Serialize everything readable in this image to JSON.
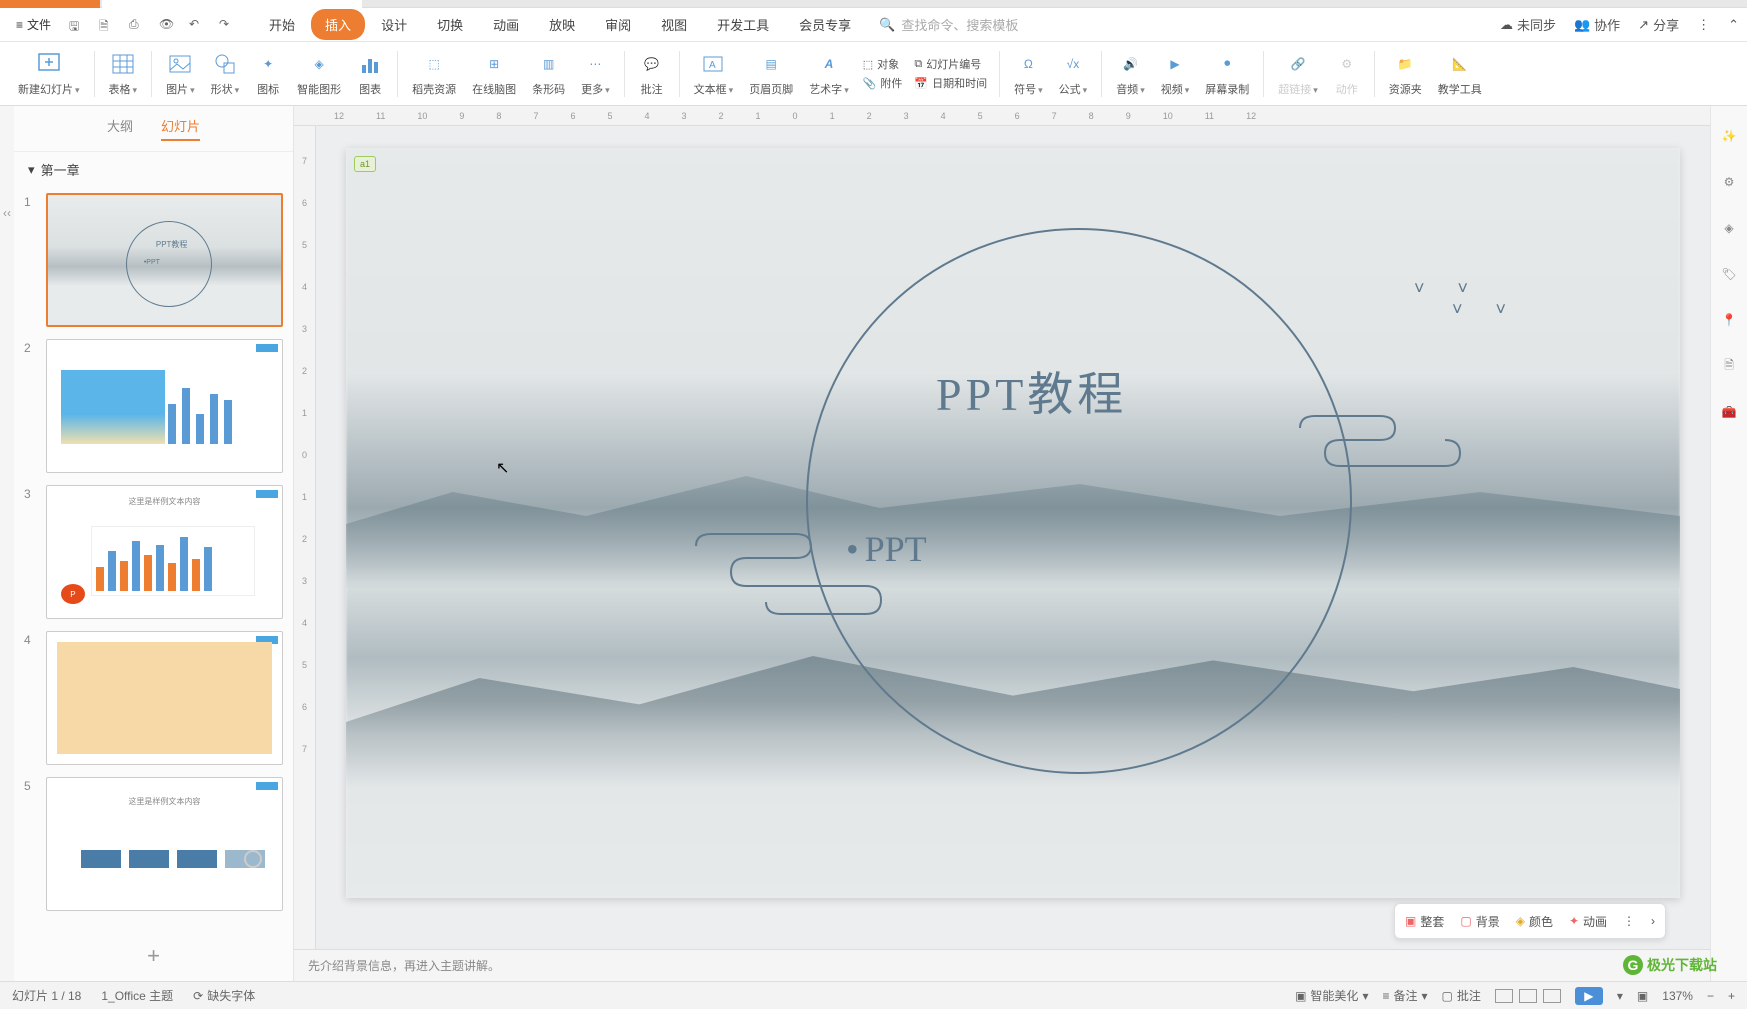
{
  "menubar": {
    "file": "文件",
    "tabs": [
      "开始",
      "插入",
      "设计",
      "切换",
      "动画",
      "放映",
      "审阅",
      "视图",
      "开发工具",
      "会员专享"
    ],
    "active_tab_index": 1,
    "search_placeholder": "查找命令、搜索模板",
    "right": {
      "unsync": "未同步",
      "collab": "协作",
      "share": "分享"
    }
  },
  "ribbon": {
    "items": [
      {
        "label": "新建幻灯片",
        "dd": true
      },
      {
        "label": "表格",
        "dd": true
      },
      {
        "label": "图片",
        "dd": true
      },
      {
        "label": "形状",
        "dd": true
      },
      {
        "label": "图标"
      },
      {
        "label": "智能图形"
      },
      {
        "label": "图表"
      },
      {
        "label": "稻壳资源"
      },
      {
        "label": "在线脑图"
      },
      {
        "label": "条形码"
      },
      {
        "label": "更多",
        "dd": true
      },
      {
        "label": "批注"
      },
      {
        "label": "文本框",
        "dd": true
      },
      {
        "label": "页眉页脚"
      },
      {
        "label": "艺术字",
        "dd": true
      },
      {
        "label": "符号",
        "dd": true
      },
      {
        "label": "公式",
        "dd": true
      },
      {
        "label": "音频",
        "dd": true
      },
      {
        "label": "视频",
        "dd": true
      },
      {
        "label": "屏幕录制"
      },
      {
        "label": "超链接",
        "dd": true,
        "disabled": true
      },
      {
        "label": "动作",
        "disabled": true
      },
      {
        "label": "资源夹"
      },
      {
        "label": "教学工具"
      }
    ],
    "col_objects": {
      "object": "对象",
      "slide_number": "幻灯片编号",
      "attachment": "附件",
      "date_time": "日期和时间"
    }
  },
  "panel": {
    "tabs": {
      "outline": "大纲",
      "slides": "幻灯片"
    },
    "chapter": "第一章",
    "thumb1": {
      "t1": "PPT教程",
      "t2": "•PPT"
    },
    "thumb3_title": "这里是样例文本内容",
    "thumb5_title": "这里是样例文本内容"
  },
  "slide": {
    "title": "PPT教程",
    "subtitle": "PPT",
    "comment_marker": "a1"
  },
  "float_toolbar": {
    "set": "整套",
    "bg": "背景",
    "color": "颜色",
    "anim": "动画"
  },
  "notes": "先介绍背景信息，再进入主题讲解。",
  "statusbar": {
    "slide_info": "幻灯片 1 / 18",
    "theme": "1_Office 主题",
    "missing_font": "缺失字体",
    "beautify": "智能美化",
    "notes_btn": "备注",
    "comments_btn": "批注",
    "zoom": "137%"
  },
  "ruler_h": [
    "12",
    "11",
    "10",
    "9",
    "8",
    "7",
    "6",
    "5",
    "4",
    "3",
    "2",
    "1",
    "0",
    "1",
    "2",
    "3",
    "4",
    "5",
    "6",
    "7",
    "8",
    "9",
    "10",
    "11",
    "12"
  ],
  "ruler_v": [
    "7",
    "6",
    "5",
    "4",
    "3",
    "2",
    "1",
    "0",
    "1",
    "2",
    "3",
    "4",
    "5",
    "6",
    "7"
  ],
  "watermark": "极光下载站"
}
